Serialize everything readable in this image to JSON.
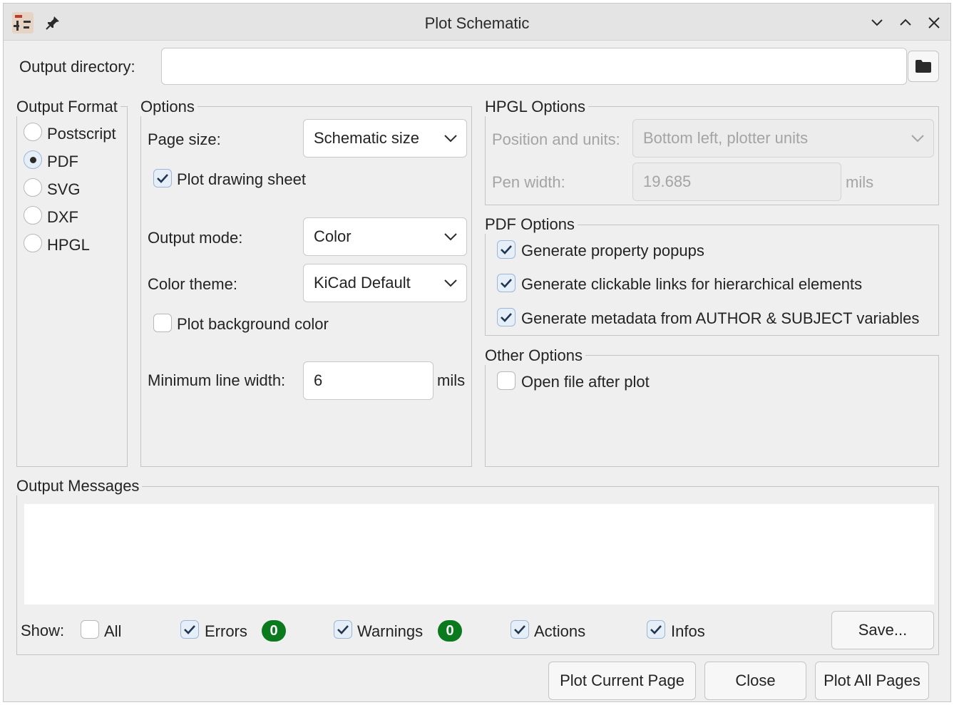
{
  "window": {
    "title": "Plot Schematic"
  },
  "titlebar_icons": [
    "kicad-eeschema-app-icon",
    "pin-icon",
    "minimize-icon",
    "maximize-icon",
    "close-icon"
  ],
  "output_directory": {
    "label": "Output directory:",
    "value": "",
    "browse_icon": "folder-icon"
  },
  "output_format": {
    "title": "Output Format",
    "options": [
      "Postscript",
      "PDF",
      "SVG",
      "DXF",
      "HPGL"
    ],
    "selected": "PDF"
  },
  "options": {
    "title": "Options",
    "page_size_label": "Page size:",
    "page_size_value": "Schematic size",
    "plot_drawing_sheet": {
      "label": "Plot drawing sheet",
      "checked": true
    },
    "output_mode_label": "Output mode:",
    "output_mode_value": "Color",
    "color_theme_label": "Color theme:",
    "color_theme_value": "KiCad Default",
    "plot_background": {
      "label": "Plot background color",
      "checked": false
    },
    "min_line_width_label": "Minimum line width:",
    "min_line_width_value": "6",
    "min_line_width_unit": "mils"
  },
  "hpgl_options": {
    "title": "HPGL Options",
    "position_label": "Position and units:",
    "position_value": "Bottom left, plotter units",
    "pen_width_label": "Pen width:",
    "pen_width_value": "19.685",
    "pen_width_unit": "mils"
  },
  "pdf_options": {
    "title": "PDF Options",
    "items": [
      {
        "label": "Generate property popups",
        "checked": true
      },
      {
        "label": "Generate clickable links for hierarchical elements",
        "checked": true
      },
      {
        "label": "Generate metadata from AUTHOR & SUBJECT variables",
        "checked": true
      }
    ]
  },
  "other_options": {
    "title": "Other Options",
    "open_file": {
      "label": "Open file after plot",
      "checked": false
    }
  },
  "output_messages": {
    "title": "Output Messages",
    "show_label": "Show:",
    "filters": {
      "all": {
        "label": "All",
        "checked": false
      },
      "errors": {
        "label": "Errors",
        "checked": true,
        "count": "0"
      },
      "warnings": {
        "label": "Warnings",
        "checked": true,
        "count": "0"
      },
      "actions": {
        "label": "Actions",
        "checked": true
      },
      "infos": {
        "label": "Infos",
        "checked": true
      }
    },
    "save_label": "Save..."
  },
  "buttons": {
    "plot_current": "Plot Current Page",
    "close": "Close",
    "plot_all": "Plot All Pages"
  },
  "colors": {
    "badge_green": "#0b7a1f",
    "checkbox_fill": "#e6eef8"
  }
}
